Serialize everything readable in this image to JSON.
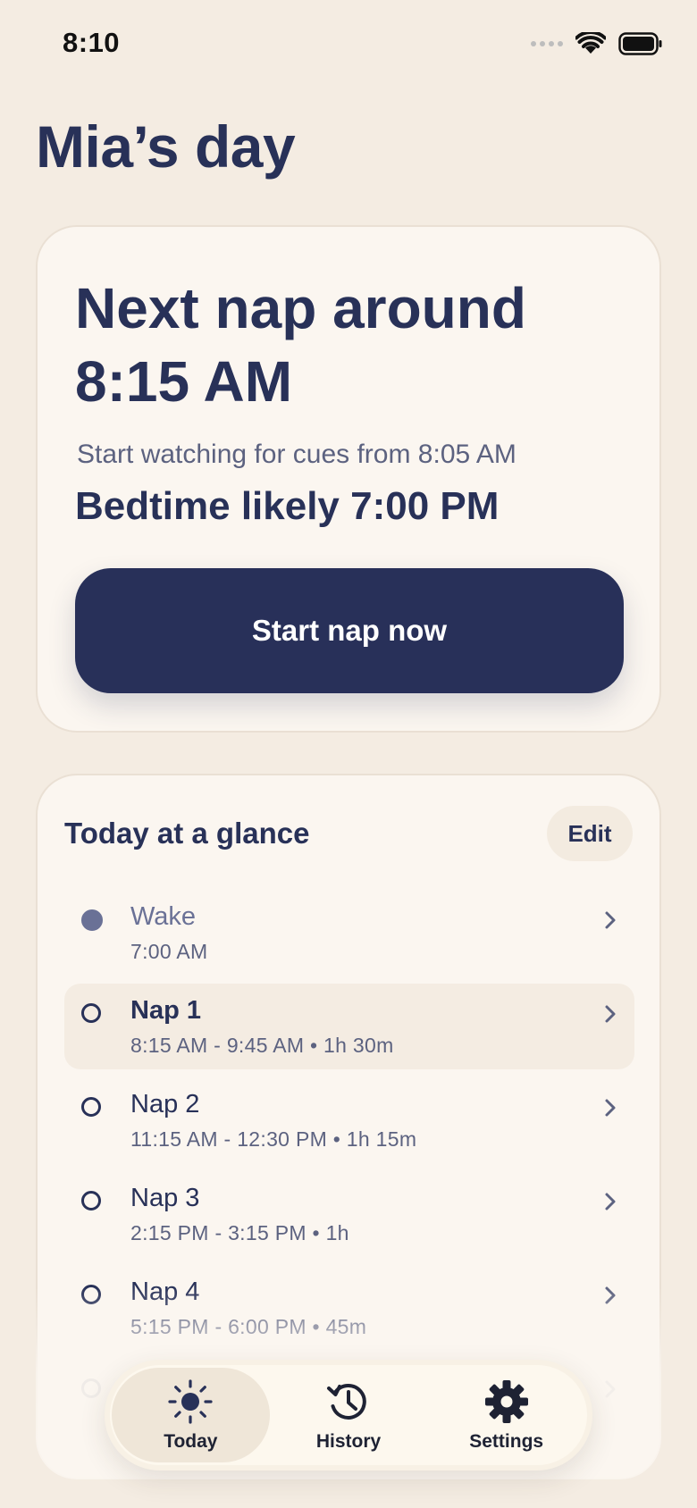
{
  "status_bar": {
    "time": "8:10"
  },
  "page_title": "Mia’s day",
  "hero": {
    "title": "Next nap around 8:15 AM",
    "cue_text": "Start watching for cues from 8:05 AM",
    "bedtime": "Bedtime likely 7:00 PM",
    "button_label": "Start nap now"
  },
  "glance": {
    "title": "Today at a glance",
    "edit_label": "Edit",
    "items": [
      {
        "label": "Wake",
        "times": "7:00 AM"
      },
      {
        "label": "Nap 1",
        "times": "8:15 AM - 9:45 AM • 1h 30m"
      },
      {
        "label": "Nap 2",
        "times": "11:15 AM - 12:30 PM • 1h 15m"
      },
      {
        "label": "Nap 3",
        "times": "2:15 PM - 3:15 PM • 1h"
      },
      {
        "label": "Nap 4",
        "times": "5:15 PM - 6:00 PM • 45m"
      }
    ]
  },
  "tabs": [
    {
      "label": "Today",
      "icon": "sun-icon",
      "active": true
    },
    {
      "label": "History",
      "icon": "history-icon",
      "active": false
    },
    {
      "label": "Settings",
      "icon": "gear-icon",
      "active": false
    }
  ],
  "colors": {
    "background": "#F4ECE2",
    "card": "#FBF6F0",
    "primary": "#283059",
    "muted": "#5C6280"
  }
}
